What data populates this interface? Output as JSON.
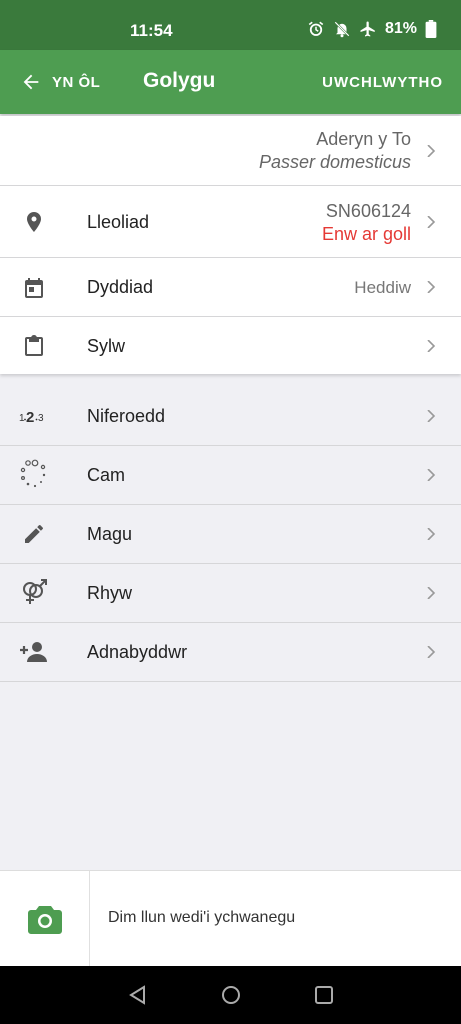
{
  "status_bar": {
    "time": "11:54",
    "battery": "81%"
  },
  "app_bar": {
    "back_label": "YN ÔL",
    "title": "Golygu",
    "upload_label": "UWCHLWYTHO"
  },
  "species": {
    "common_name": "Aderyn y To",
    "latin_name": "Passer domesticus"
  },
  "location": {
    "label": "Lleoliad",
    "grid_ref": "SN606124",
    "missing_name": "Enw ar goll"
  },
  "date": {
    "label": "Dyddiad",
    "value": "Heddiw"
  },
  "comment": {
    "label": "Sylw"
  },
  "attributes": [
    {
      "label": "Niferoedd",
      "icon": "numbers-123-icon"
    },
    {
      "label": "Cam",
      "icon": "stage-dots-icon"
    },
    {
      "label": "Magu",
      "icon": "pencil-icon"
    },
    {
      "label": "Rhyw",
      "icon": "gender-icon"
    },
    {
      "label": "Adnabyddwr",
      "icon": "person-add-icon"
    }
  ],
  "photo": {
    "empty_text": "Dim llun wedi'i ychwanegu"
  },
  "colors": {
    "status_bar": "#3a7a3c",
    "app_bar": "#4e9d51",
    "error": "#e53935",
    "camera": "#4e9d51"
  }
}
